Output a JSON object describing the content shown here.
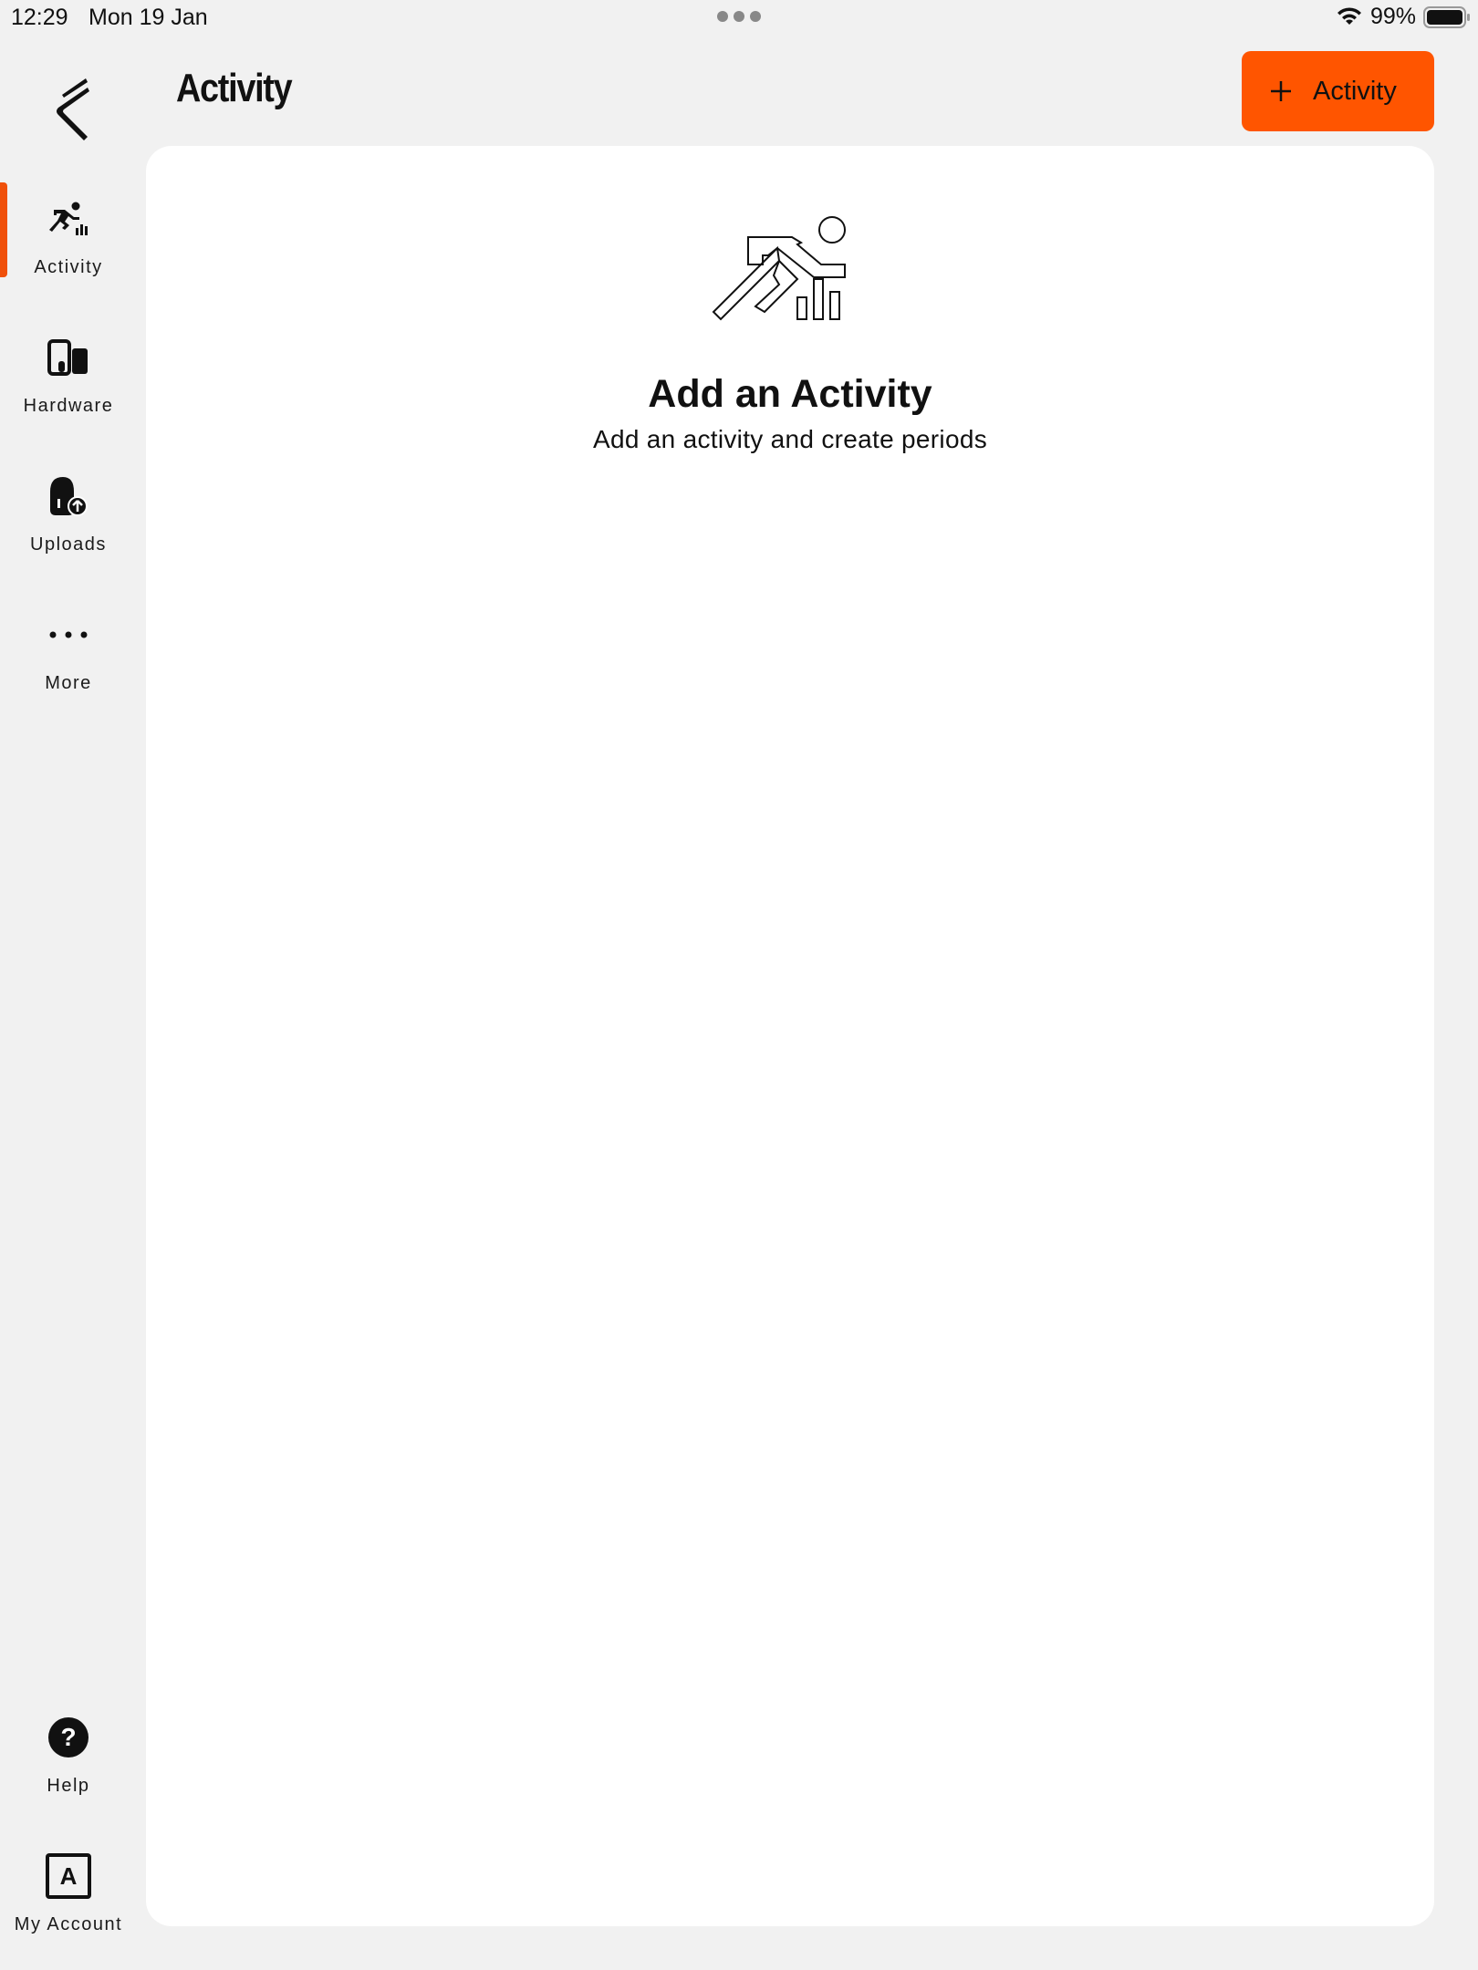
{
  "status_bar": {
    "time": "12:29",
    "date": "Mon 19 Jan",
    "battery": "99%"
  },
  "sidebar": {
    "items": [
      {
        "label": "Activity",
        "icon": "activity-runner-icon",
        "active": true
      },
      {
        "label": "Hardware",
        "icon": "hardware-devices-icon",
        "active": false
      },
      {
        "label": "Uploads",
        "icon": "uploads-icon",
        "active": false
      },
      {
        "label": "More",
        "icon": "more-dots-icon",
        "active": false
      }
    ],
    "bottom_items": [
      {
        "label": "Help",
        "icon": "help-icon"
      },
      {
        "label": "My Account",
        "icon": "account-icon",
        "avatar_letter": "A"
      }
    ]
  },
  "header": {
    "title": "Activity",
    "add_button_label": "Activity"
  },
  "empty_state": {
    "title": "Add an Activity",
    "subtitle": "Add an activity and create periods"
  },
  "colors": {
    "accent": "#ff5500",
    "indicator": "#f0500a",
    "background": "#f1f1f1",
    "card": "#ffffff"
  }
}
